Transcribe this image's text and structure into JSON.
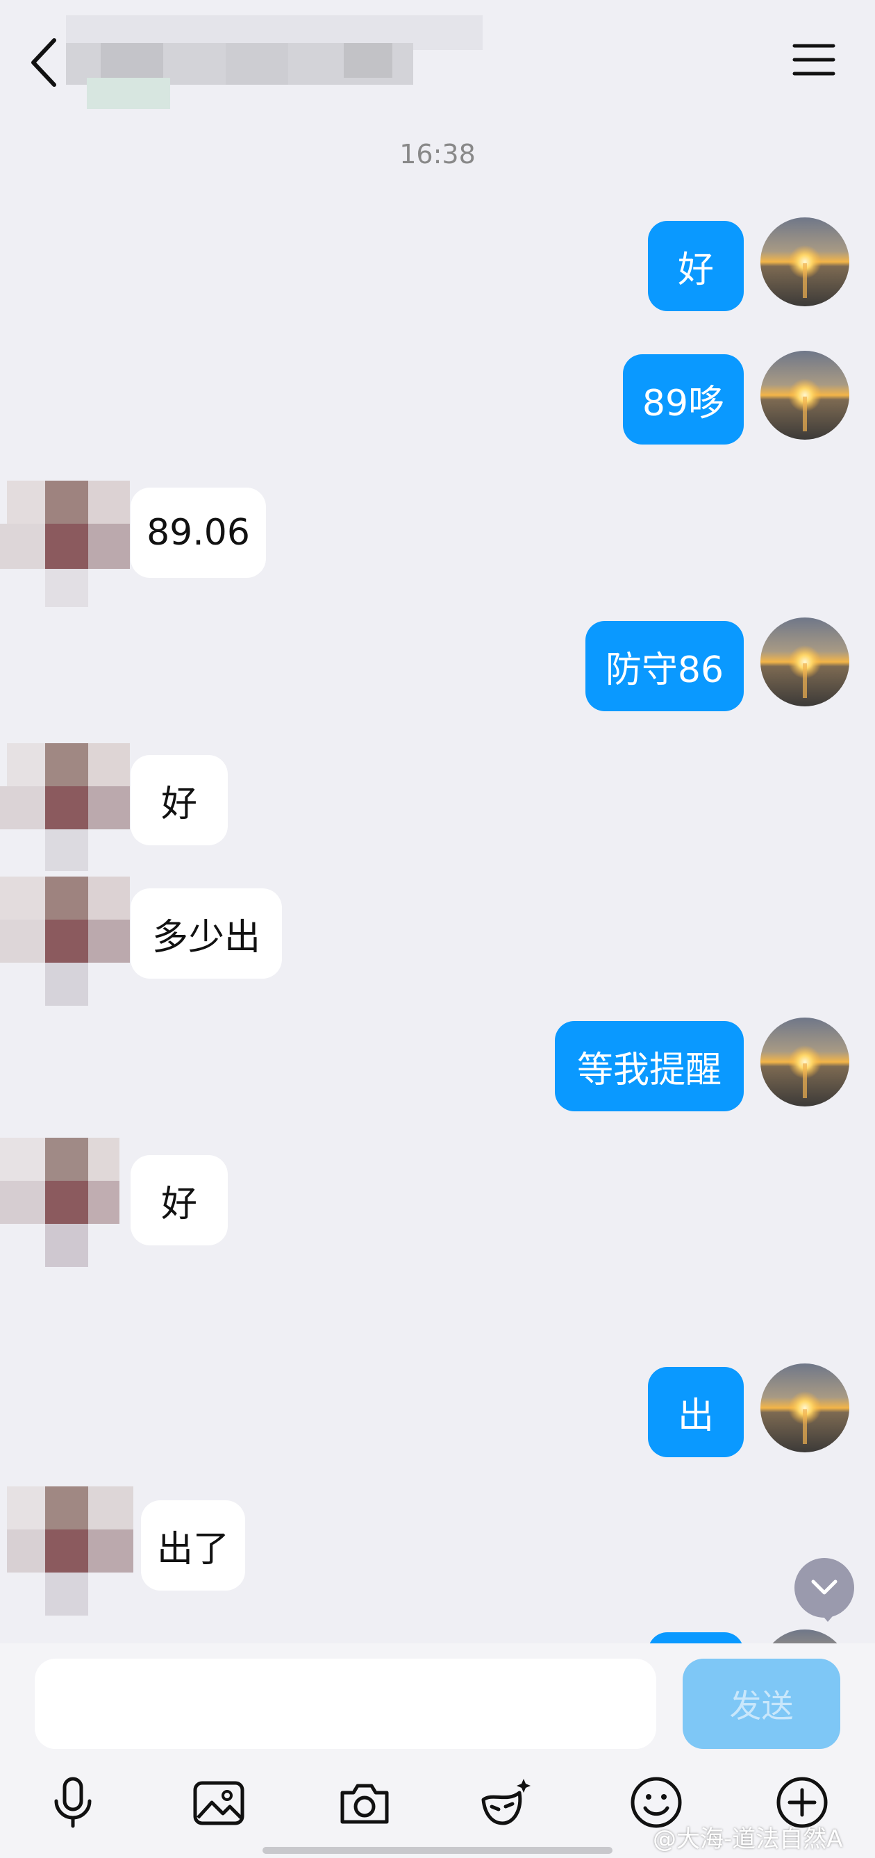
{
  "header": {
    "back_icon": "chevron-left-icon",
    "menu_icon": "hamburger-menu-icon",
    "title": ""
  },
  "time_stamp": "16:38",
  "messages": [
    {
      "direction": "out",
      "text": "好"
    },
    {
      "direction": "out",
      "text": "89哆"
    },
    {
      "direction": "in",
      "text": "89.06"
    },
    {
      "direction": "out",
      "text": "防守86"
    },
    {
      "direction": "in",
      "text": "好"
    },
    {
      "direction": "in",
      "text": "多少出"
    },
    {
      "direction": "out",
      "text": "等我提醒"
    },
    {
      "direction": "in",
      "text": "好"
    },
    {
      "direction": "out",
      "text": "出"
    },
    {
      "direction": "in",
      "text": "出了"
    }
  ],
  "input": {
    "value": "",
    "send_label": "发送"
  },
  "toolbar": {
    "icons": [
      "microphone-icon",
      "image-icon",
      "camera-icon",
      "mask-icon",
      "emoji-icon",
      "plus-icon"
    ]
  },
  "watermark": "@大海-道法自然A",
  "colors": {
    "background": "#efeff4",
    "outgoing_bubble": "#0a99ff",
    "incoming_bubble": "#ffffff",
    "send_button": "#7ec7f6"
  }
}
